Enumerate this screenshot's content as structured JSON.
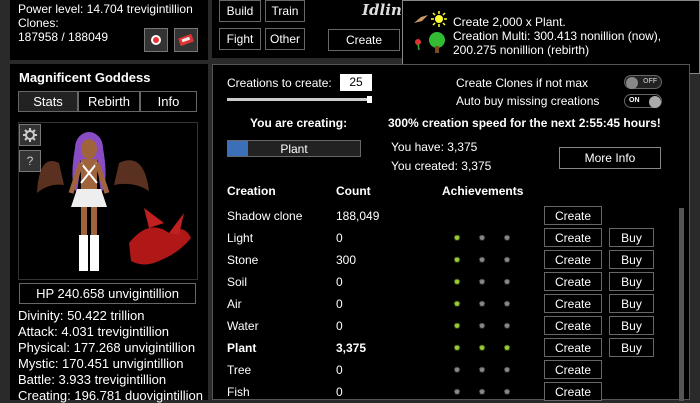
{
  "stats_top": {
    "power_level": "Power level: 14.704 trevigintillion",
    "clones_label": "Clones:",
    "clones_value": "187958 / 188049"
  },
  "nav": {
    "build": "Build",
    "train": "Train",
    "fight": "Fight",
    "other": "Other",
    "create": "Create",
    "title_partial": "Idlin"
  },
  "tooltip": {
    "line1": "Create 2,000 x Plant.",
    "line2": "Creation Multi: 300.413 nonillion (now),",
    "line3": "200.275 nonillion (rebirth)"
  },
  "character": {
    "name": "Magnificent Goddess",
    "tabs": [
      "Stats",
      "Rebirth",
      "Info"
    ],
    "hp": "HP 240.658 unvigintillion",
    "stats": [
      "Divinity: 50.422 trillion",
      "Attack: 4.031 trevigintillion",
      "Physical: 177.268 unvigintillion",
      "Mystic: 170.451 unvigintillion",
      "Battle: 3.933 trevigintillion",
      "Creating: 196.781 duovigintillion"
    ],
    "settings_label": "",
    "help_label": "?"
  },
  "creation": {
    "to_create_label": "Creations to create:",
    "to_create_value": "25",
    "clones_label": "Create Clones if not max",
    "clones_toggle": "OFF",
    "auto_buy_label": "Auto buy missing creations",
    "auto_buy_toggle": "ON",
    "slider_fraction": 1.0,
    "you_are_creating_label": "You are creating:",
    "current_item": "Plant",
    "speed_text": "300% creation speed for the next 2:55:45 hours!",
    "you_have": "You have: 3,375",
    "you_created": "You created: 3,375",
    "more_info": "More Info"
  },
  "table": {
    "headers": [
      "Creation",
      "Count",
      "Achievements"
    ],
    "rows": [
      {
        "name": "Shadow clone",
        "count": "188,049",
        "create": "Create",
        "buy": "",
        "bold": false,
        "ach": []
      },
      {
        "name": "Light",
        "count": "0",
        "create": "Create",
        "buy": "Buy",
        "bold": false,
        "ach": [
          true,
          false,
          false
        ]
      },
      {
        "name": "Stone",
        "count": "300",
        "create": "Create",
        "buy": "Buy",
        "bold": false,
        "ach": [
          true,
          false,
          false
        ]
      },
      {
        "name": "Soil",
        "count": "0",
        "create": "Create",
        "buy": "Buy",
        "bold": false,
        "ach": [
          true,
          false,
          false
        ]
      },
      {
        "name": "Air",
        "count": "0",
        "create": "Create",
        "buy": "Buy",
        "bold": false,
        "ach": [
          true,
          false,
          false
        ]
      },
      {
        "name": "Water",
        "count": "0",
        "create": "Create",
        "buy": "Buy",
        "bold": false,
        "ach": [
          true,
          false,
          false
        ]
      },
      {
        "name": "Plant",
        "count": "3,375",
        "create": "Create",
        "buy": "Buy",
        "bold": true,
        "ach": [
          true,
          true,
          true
        ]
      },
      {
        "name": "Tree",
        "count": "0",
        "create": "Create",
        "buy": "",
        "bold": false,
        "ach": [
          false,
          false,
          false
        ]
      },
      {
        "name": "Fish",
        "count": "0",
        "create": "Create",
        "buy": "",
        "bold": false,
        "ach": [
          false,
          false,
          false
        ]
      }
    ]
  }
}
